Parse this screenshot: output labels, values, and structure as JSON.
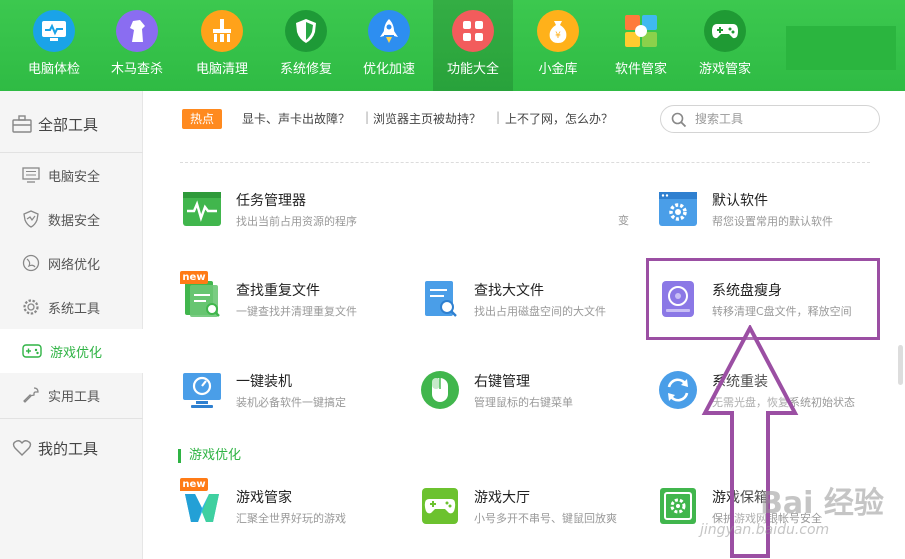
{
  "toolbar": {
    "items": [
      {
        "label": "电脑体检",
        "icon": "monitor-checkup-icon",
        "color": "#1aa3e8"
      },
      {
        "label": "木马查杀",
        "icon": "horse-icon",
        "color": "#8a6df1"
      },
      {
        "label": "电脑清理",
        "icon": "broom-icon",
        "color": "#ffa21a"
      },
      {
        "label": "系统修复",
        "icon": "shield-icon",
        "color": "#28a745"
      },
      {
        "label": "优化加速",
        "icon": "rocket-icon",
        "color": "#2d8ef0"
      },
      {
        "label": "功能大全",
        "icon": "grid-icon",
        "color": "#f25c5c"
      },
      {
        "label": "小金库",
        "icon": "money-bag-icon",
        "color": "#ffb11a"
      },
      {
        "label": "软件管家",
        "icon": "software-icon",
        "color": "#ffffff"
      },
      {
        "label": "游戏管家",
        "icon": "gamepad-icon",
        "color": "#25a53b"
      }
    ],
    "active_index": 5
  },
  "sidebar": {
    "all_tools": "全部工具",
    "items": [
      {
        "label": "电脑安全",
        "icon": "monitor-icon"
      },
      {
        "label": "数据安全",
        "icon": "data-shield-icon"
      },
      {
        "label": "网络优化",
        "icon": "globe-icon"
      },
      {
        "label": "系统工具",
        "icon": "gear-icon"
      },
      {
        "label": "游戏优化",
        "icon": "gamepad-icon"
      },
      {
        "label": "实用工具",
        "icon": "wrench-icon"
      }
    ],
    "active_index": 4,
    "my_tools": "我的工具"
  },
  "hotbar": {
    "badge": "热点",
    "links": [
      "显卡、声卡出故障？",
      "浏览器主页被劫持？",
      "上不了网，怎么办？"
    ]
  },
  "search": {
    "placeholder": "搜索工具"
  },
  "tools": {
    "task_manager": {
      "name": "任务管理器",
      "desc": "找出当前占用资源的程序"
    },
    "default_software": {
      "name": "默认软件",
      "desc": "帮您设置常用的默认软件"
    },
    "find_duplicate": {
      "name": "查找重复文件",
      "desc": "一键查找并清理重复文件",
      "badge": "new"
    },
    "find_large": {
      "name": "查找大文件",
      "desc": "找出占用磁盘空间的大文件"
    },
    "system_slim": {
      "name": "系统盘瘦身",
      "desc": "转移清理C盘文件，释放空间"
    },
    "one_click_install": {
      "name": "一键装机",
      "desc": "装机必备软件一键搞定"
    },
    "right_click_mgr": {
      "name": "右键管理",
      "desc": "管理鼠标的右键菜单"
    },
    "system_reinstall": {
      "name": "系统重装",
      "desc": "无需光盘，恢复系统初始状态"
    },
    "game_manager": {
      "name": "游戏管家",
      "desc": "汇聚全世界好玩的游戏",
      "badge": "new"
    },
    "game_hall": {
      "name": "游戏大厅",
      "desc": "小号多开不串号、键鼠回放爽"
    },
    "game_safe": {
      "name": "游戏保箱",
      "desc": "保护游戏网银帐号安全"
    }
  },
  "stray_text": "变",
  "section": {
    "game_title": "游戏优化"
  },
  "watermark": {
    "text": "Bai 经验",
    "sub": "jingyan.baidu.com"
  },
  "colors": {
    "brand_green": "#2fbb44",
    "highlight": "#9b4fa3",
    "hot_orange": "#ff8a1f"
  }
}
